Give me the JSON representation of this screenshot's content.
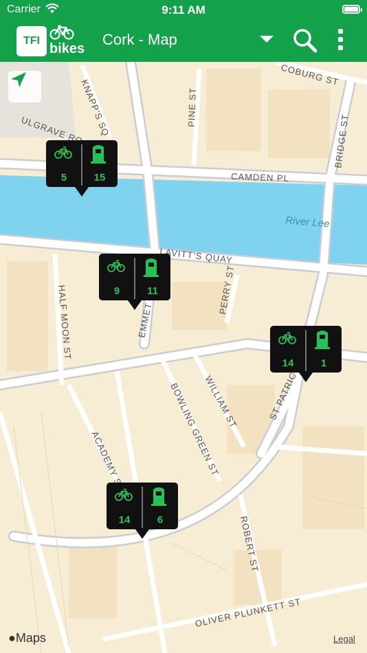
{
  "status": {
    "carrier": "Carrier",
    "time": "9:11 AM"
  },
  "nav": {
    "logo_text": "TFI",
    "brand": "bikes",
    "title": "Cork - Map"
  },
  "map": {
    "streets": {
      "coburg": "COBURG ST",
      "knapps": "KNAPP'S SQ",
      "pine": "PINE ST",
      "bridge": "BRIDGE ST",
      "mulgrave": "ULGRAVE RO",
      "camden": "CAMDEN PL",
      "river": "River Lee",
      "lavitt": "LAVITT'S QUAY",
      "perry": "PERRY ST",
      "halfmoon": "HALF MOON ST",
      "emmet": "EMMET",
      "bowling": "BOWLING GREEN ST",
      "william": "WILLIAM ST",
      "stpatrick": "ST PATRIC",
      "academy": "ACADEMY ST",
      "robert": "ROBERT ST",
      "oliver": "OLIVER PLUNKETT ST"
    },
    "stations": [
      {
        "bikes": "5",
        "docks": "15"
      },
      {
        "bikes": "9",
        "docks": "11"
      },
      {
        "bikes": "14",
        "docks": "1"
      },
      {
        "bikes": "14",
        "docks": "6"
      }
    ],
    "attribution": "Maps",
    "legal": "Legal"
  },
  "colors": {
    "brand_green": "#13a24a",
    "marker_green": "#27c15a",
    "water": "#7fd3ef",
    "land": "#f7ecd4"
  },
  "icons": [
    "wifi-icon",
    "battery-icon",
    "bike-icon",
    "dropdown-icon",
    "search-icon",
    "more-icon",
    "locate-arrow-icon",
    "dock-icon",
    "apple-icon"
  ]
}
